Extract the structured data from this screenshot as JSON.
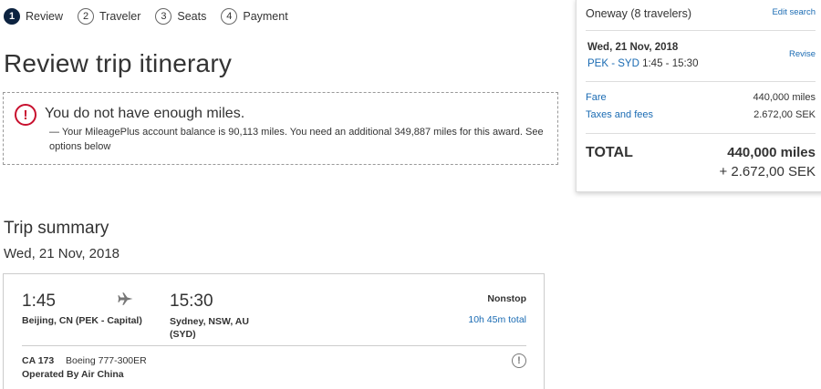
{
  "steps": [
    {
      "num": "1",
      "label": "Review"
    },
    {
      "num": "2",
      "label": "Traveler"
    },
    {
      "num": "3",
      "label": "Seats"
    },
    {
      "num": "4",
      "label": "Payment"
    }
  ],
  "page_title": "Review trip itinerary",
  "alert": {
    "title": "You do not have enough miles.",
    "detail": "— Your MileagePlus account balance is 90,113 miles. You need an additional 349,887 miles for this award. See options below",
    "icon": "exclamation-circle-icon",
    "color": "#c8102e"
  },
  "summary": {
    "title": "Trip summary",
    "date": "Wed, 21 Nov, 2018"
  },
  "flight": {
    "departure_time": "1:45",
    "arrival_time": "15:30",
    "departure_city": "Beijing, CN (PEK - Capital)",
    "arrival_city": "Sydney, NSW, AU (SYD)",
    "stops": "Nonstop",
    "duration": "10h 45m total",
    "flight_number": "CA 173",
    "aircraft": "Boeing 777-300ER",
    "operated_by": "Operated By Air China"
  },
  "panel": {
    "trip_type": "Oneway (8 travelers)",
    "edit_search": "Edit search",
    "date": "Wed, 21 Nov, 2018",
    "route": "PEK - SYD",
    "times": "1:45 - 15:30",
    "revise": "Revise",
    "fare_label": "Fare",
    "fare_value": "440,000 miles",
    "tax_label": "Taxes and fees",
    "tax_value": "2.672,00 SEK",
    "total_label": "TOTAL",
    "total_miles": "440,000 miles",
    "total_sek": "+ 2.672,00 SEK"
  },
  "colors": {
    "link": "#1a6bb3",
    "active_step": "#0c2340"
  }
}
